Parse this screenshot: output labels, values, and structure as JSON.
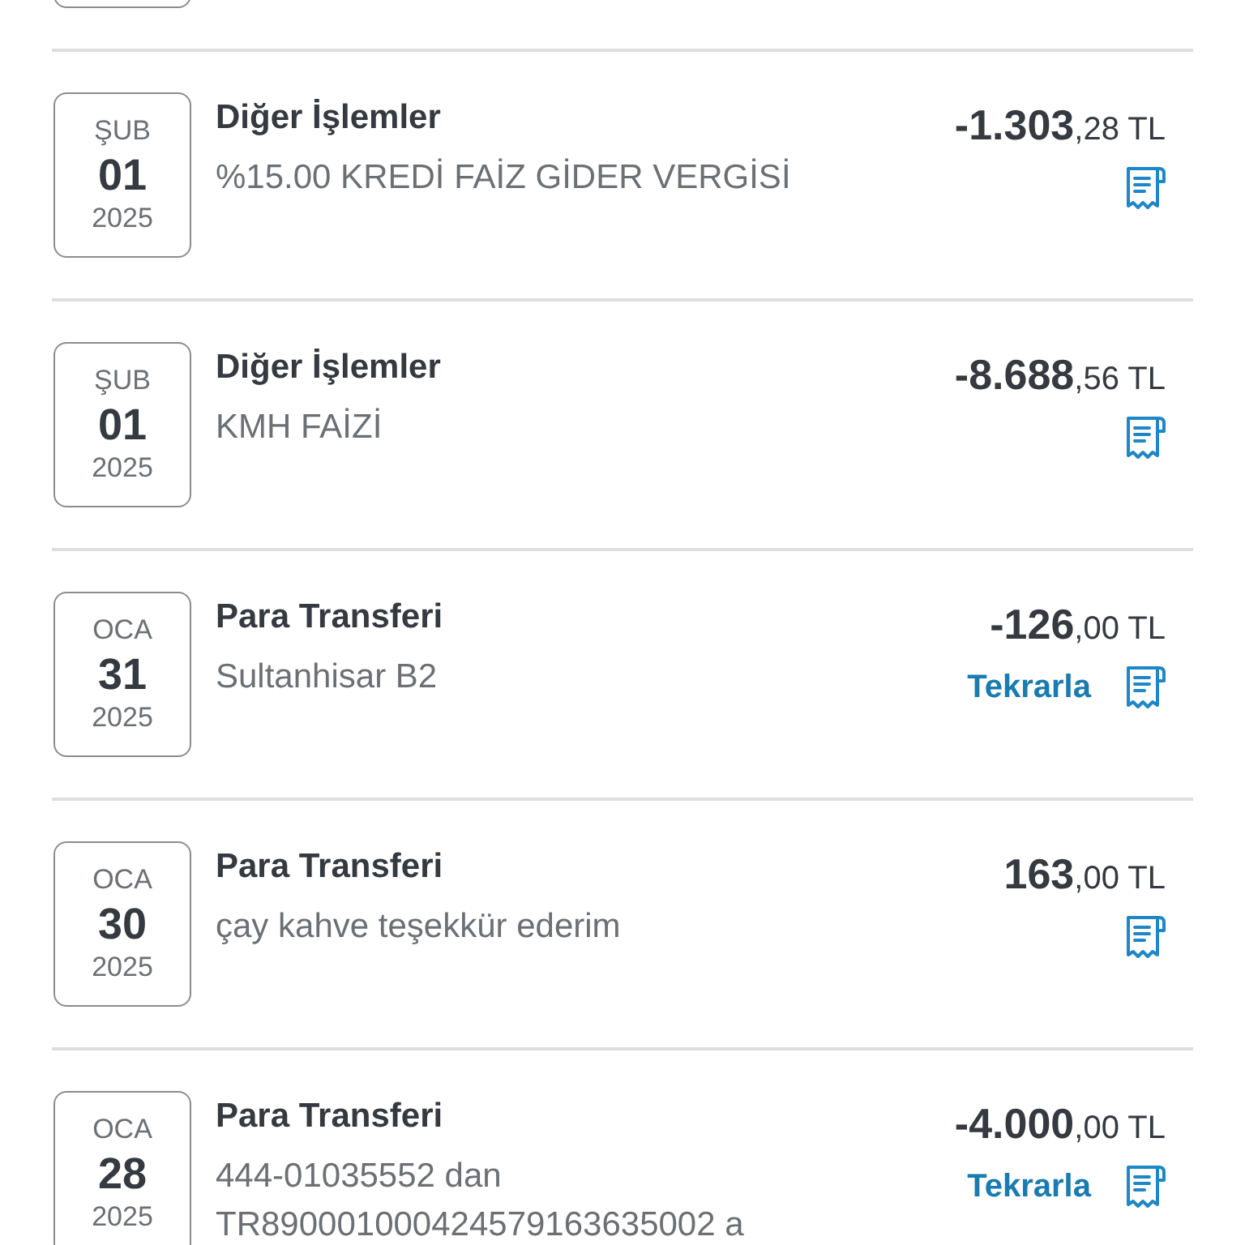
{
  "transactions": [
    {
      "month": "ŞUB",
      "day": "01",
      "year": "2025",
      "title": "Diğer İşlemler",
      "description": "%15.00 KREDİ FAİZ GİDER VERGİSİ",
      "amount_integer": "-1.303",
      "amount_fraction": ",28 TL"
    },
    {
      "month": "ŞUB",
      "day": "01",
      "year": "2025",
      "title": "Diğer İşlemler",
      "description": "KMH FAİZİ",
      "amount_integer": "-8.688",
      "amount_fraction": ",56 TL"
    },
    {
      "month": "OCA",
      "day": "31",
      "year": "2025",
      "title": "Para Transferi",
      "description": "Sultanhisar B2",
      "amount_integer": "-126",
      "amount_fraction": ",00 TL",
      "repeat_label": "Tekrarla"
    },
    {
      "month": "OCA",
      "day": "30",
      "year": "2025",
      "title": "Para Transferi",
      "description": "çay kahve teşekkür ederim",
      "amount_integer": "163",
      "amount_fraction": ",00 TL"
    },
    {
      "month": "OCA",
      "day": "28",
      "year": "2025",
      "title": "Para Transferi",
      "description": "444-01035552 dan TR890001000424579163635002 a",
      "amount_integer": "-4.000",
      "amount_fraction": ",00 TL",
      "repeat_label": "Tekrarla"
    }
  ]
}
